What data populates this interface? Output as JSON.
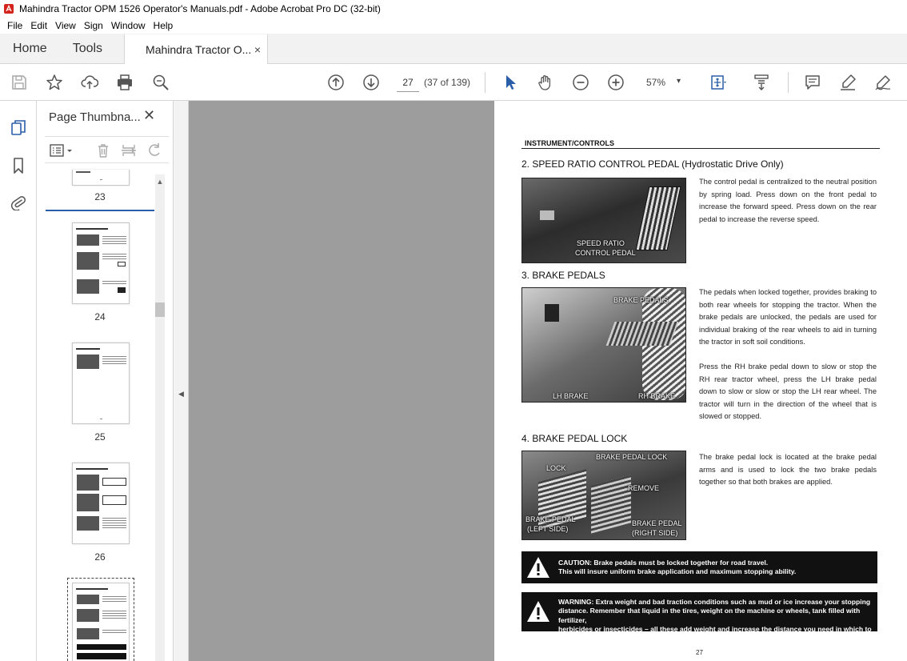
{
  "window": {
    "title": "Mahindra Tractor OPM 1526 Operator's Manuals.pdf - Adobe Acrobat Pro DC (32-bit)"
  },
  "menubar": {
    "items": [
      "File",
      "Edit",
      "View",
      "Sign",
      "Window",
      "Help"
    ]
  },
  "tabs": {
    "home": "Home",
    "tools": "Tools",
    "document": "Mahindra Tractor O...",
    "close_glyph": "×"
  },
  "toolbar": {
    "icons": [
      "save-icon",
      "star-icon",
      "upload-icon",
      "print-icon",
      "zoom-search-icon",
      "page-up-icon",
      "page-down-icon",
      "select-cursor-icon",
      "hand-icon",
      "zoom-out-icon",
      "zoom-in-icon",
      "fit-page-icon",
      "scroll-mode-icon",
      "comment-icon",
      "highlight-pen-icon",
      "sign-icon"
    ],
    "page_current": "27",
    "page_count": "(37 of 139)",
    "zoom": "57%",
    "zoom_dropdown": "▾"
  },
  "left_rail": {
    "icons": [
      "page-thumbnails-icon",
      "bookmark-icon",
      "attachment-icon"
    ]
  },
  "thumb_panel": {
    "title": "Page Thumbna...",
    "close_glyph": "✕",
    "tool_icons": [
      "options-icon",
      "delete-icon",
      "insert-icon",
      "rotate-icon"
    ],
    "pages": [
      "23",
      "24",
      "25",
      "26"
    ]
  },
  "colors": {
    "accent": "#2a5ea8",
    "canvas": "#9d9d9d",
    "panel_bg": "#f2f2f2"
  },
  "document_page": {
    "section_header": "INSTRUMENT/CONTROLS",
    "s2_heading": "2. SPEED RATIO CONTROL PEDAL (Hydrostatic Drive Only)",
    "s2_body": "The control pedal is centralized to the neutral position by spring load. Press down on the front pedal to increase the forward speed. Press down on the rear pedal to increase the reverse speed.",
    "s2_photo_label_1": "SPEED RATIO",
    "s2_photo_label_2": "CONTROL PEDAL",
    "s3_heading": "3. BRAKE PEDALS",
    "s3_body": "The pedals when locked together, provides braking to both rear wheels for stopping the tractor. When the brake pedals are unlocked, the pedals are used for individual braking of the rear wheels to aid in turning the tractor in soft soil conditions.",
    "s3_body_2": "Press the RH brake pedal down to slow or stop the RH rear tractor wheel, press the LH brake pedal down to slow or slow or stop the LH rear wheel. The tractor will turn in the direction of the wheel that is slowed or stopped.",
    "s3_photo_label_top": "BRAKE PEDALS",
    "s3_photo_label_lh": "LH BRAKE",
    "s3_photo_label_rh": "RH BRAKE",
    "s4_heading": "4. BRAKE PEDAL LOCK",
    "s4_body": "The brake pedal lock is located at the brake pedal arms and is used to lock the two brake pedals together so that both brakes are applied.",
    "s4_photo_label_lock": "LOCK",
    "s4_photo_label_bpl": "BRAKE PEDAL LOCK",
    "s4_photo_label_remove": "REMOVE",
    "s4_photo_label_left_1": "BRAKE PEDAL",
    "s4_photo_label_left_2": "(LEFT SIDE)",
    "s4_photo_label_right_1": "BRAKE PEDAL",
    "s4_photo_label_right_2": "(RIGHT SIDE)",
    "caution_line_1": "CAUTION: Brake pedals must be locked together for road travel.",
    "caution_line_2": "This will insure uniform brake application and maximum stopping ability.",
    "warning_line_1": "WARNING: Extra weight and bad traction conditions such as mud or ice increase your stopping",
    "warning_line_2": "distance. Remember that liquid in the tires, weight on the machine or wheels, tank filled with fertilizer,",
    "warning_line_3": "herbicides or insecticides – all these add weight and increase the distance you need in which to stop.",
    "page_number": "27"
  }
}
